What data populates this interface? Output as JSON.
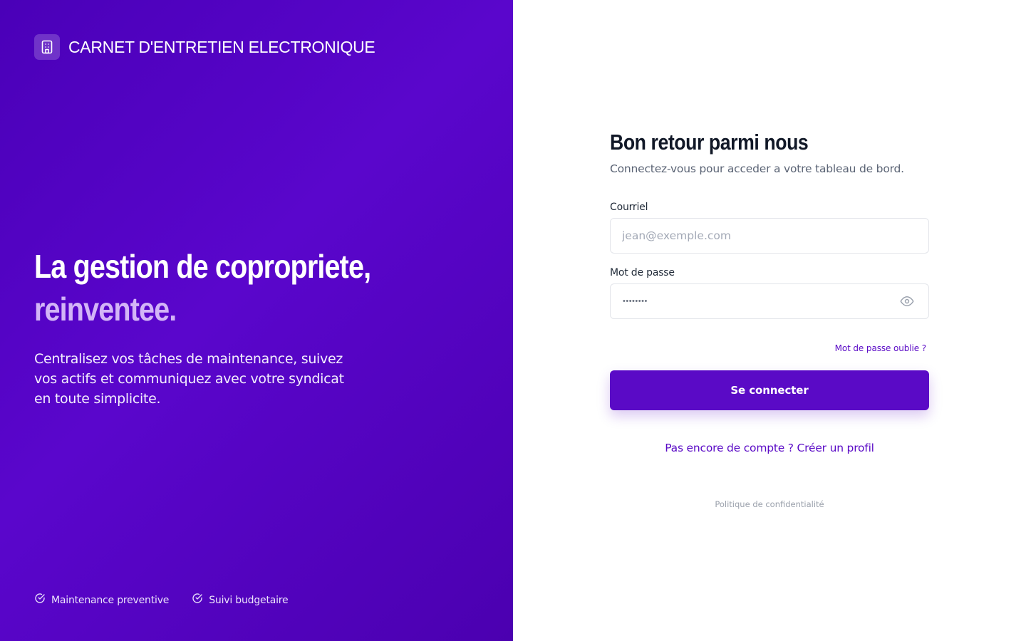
{
  "brand": {
    "name": "CARNET D'ENTRETIEN ELECTRONIQUE",
    "logo_icon": "building-icon"
  },
  "hero": {
    "title_line1": "La gestion de copropriete,",
    "title_line2": "reinventee.",
    "description": "Centralisez vos tâches de maintenance, suivez vos actifs et communiquez avec votre syndicat en toute simplicite."
  },
  "features": [
    {
      "icon": "check-circle-icon",
      "label": "Maintenance preventive"
    },
    {
      "icon": "check-circle-icon",
      "label": "Suivi budgetaire"
    }
  ],
  "login": {
    "title": "Bon retour parmi nous",
    "subtitle": "Connectez-vous pour acceder a votre tableau de bord.",
    "email": {
      "label": "Courriel",
      "placeholder": "jean@exemple.com",
      "value": ""
    },
    "password": {
      "label": "Mot de passe",
      "masked_value": "••••••••",
      "toggle_icon": "eye-icon"
    },
    "forgot_password": "Mot de passe oublie ?",
    "submit_label": "Se connecter",
    "signup_link": "Pas encore de compte ? Créer un profil",
    "privacy_link": "Politique de confidentialité"
  },
  "colors": {
    "panel_gradient_start": "#4a00b8",
    "panel_gradient_mid": "#5a06cc",
    "accent": "#5a0ac6",
    "hero_highlight": "#d3b5f7",
    "title_text": "#111827",
    "muted_text": "#5b6475"
  }
}
